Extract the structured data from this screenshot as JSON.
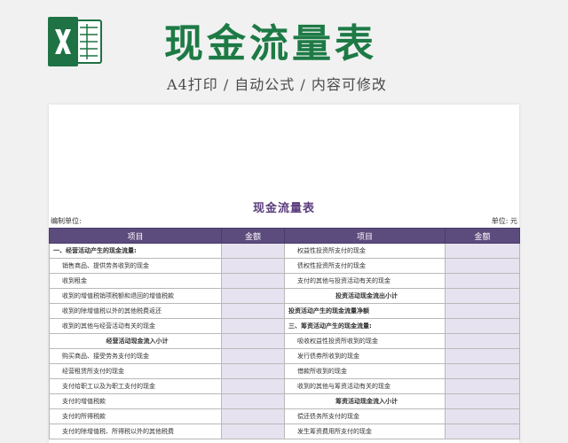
{
  "header": {
    "title": "现金流量表",
    "subtitle": "A4打印 / 自动公式 / 内容可修改"
  },
  "sheet": {
    "title": "现金流量表",
    "unit_left": "编制单位:",
    "unit_right": "单位: 元",
    "columns": [
      "项目",
      "金额",
      "项目",
      "金额"
    ],
    "left_rows": [
      {
        "text": "一、经营活动产生的现金流量:",
        "style": "b"
      },
      {
        "text": "销售商品、提供劳务收到的现金",
        "style": "i"
      },
      {
        "text": "收到租金",
        "style": "i"
      },
      {
        "text": "收到的增值税销项税额和退回的增值税款",
        "style": "i"
      },
      {
        "text": "收到的除增值税以外的其他税费返还",
        "style": "i"
      },
      {
        "text": "收到的其他与经营活动有关的现金",
        "style": "i"
      },
      {
        "text": "经营活动现金流入小计",
        "style": "c"
      },
      {
        "text": "购买商品、接受劳务支付的现金",
        "style": "i"
      },
      {
        "text": "经营租赁所支付的现金",
        "style": "i"
      },
      {
        "text": "支付给职工以及为职工支付的现金",
        "style": "i"
      },
      {
        "text": "支付的增值税款",
        "style": "i"
      },
      {
        "text": "支付的所得税款",
        "style": "i"
      },
      {
        "text": "支付的除增值税、所得税以外的其他税费",
        "style": "i"
      }
    ],
    "right_rows": [
      {
        "text": "权益性投资所支付的现金",
        "style": "i"
      },
      {
        "text": "债权性投资所支付的现金",
        "style": "i"
      },
      {
        "text": "支付的其他与投资活动有关的现金",
        "style": "i"
      },
      {
        "text": "投资活动现金流出小计",
        "style": "c"
      },
      {
        "text": "投资活动产生的现金流量净额",
        "style": "b"
      },
      {
        "text": "三、筹资活动产生的现金流量:",
        "style": "b"
      },
      {
        "text": "吸收权益性投资所收到的现金",
        "style": "i"
      },
      {
        "text": "发行债券所收到的现金",
        "style": "i"
      },
      {
        "text": "借款所收到的现金",
        "style": "i"
      },
      {
        "text": "收到的其他与筹资活动有关的现金",
        "style": "i"
      },
      {
        "text": "筹资活动现金流入小计",
        "style": "c"
      },
      {
        "text": "偿还债务所支付的现金",
        "style": "i"
      },
      {
        "text": "发生筹资费用所支付的现金",
        "style": "i"
      }
    ]
  },
  "icons": {
    "app": "excel-icon"
  },
  "colors": {
    "title_green": "#1d7a45",
    "header_purple": "#5c4b7d",
    "amount_fill": "#e6e2ef"
  }
}
